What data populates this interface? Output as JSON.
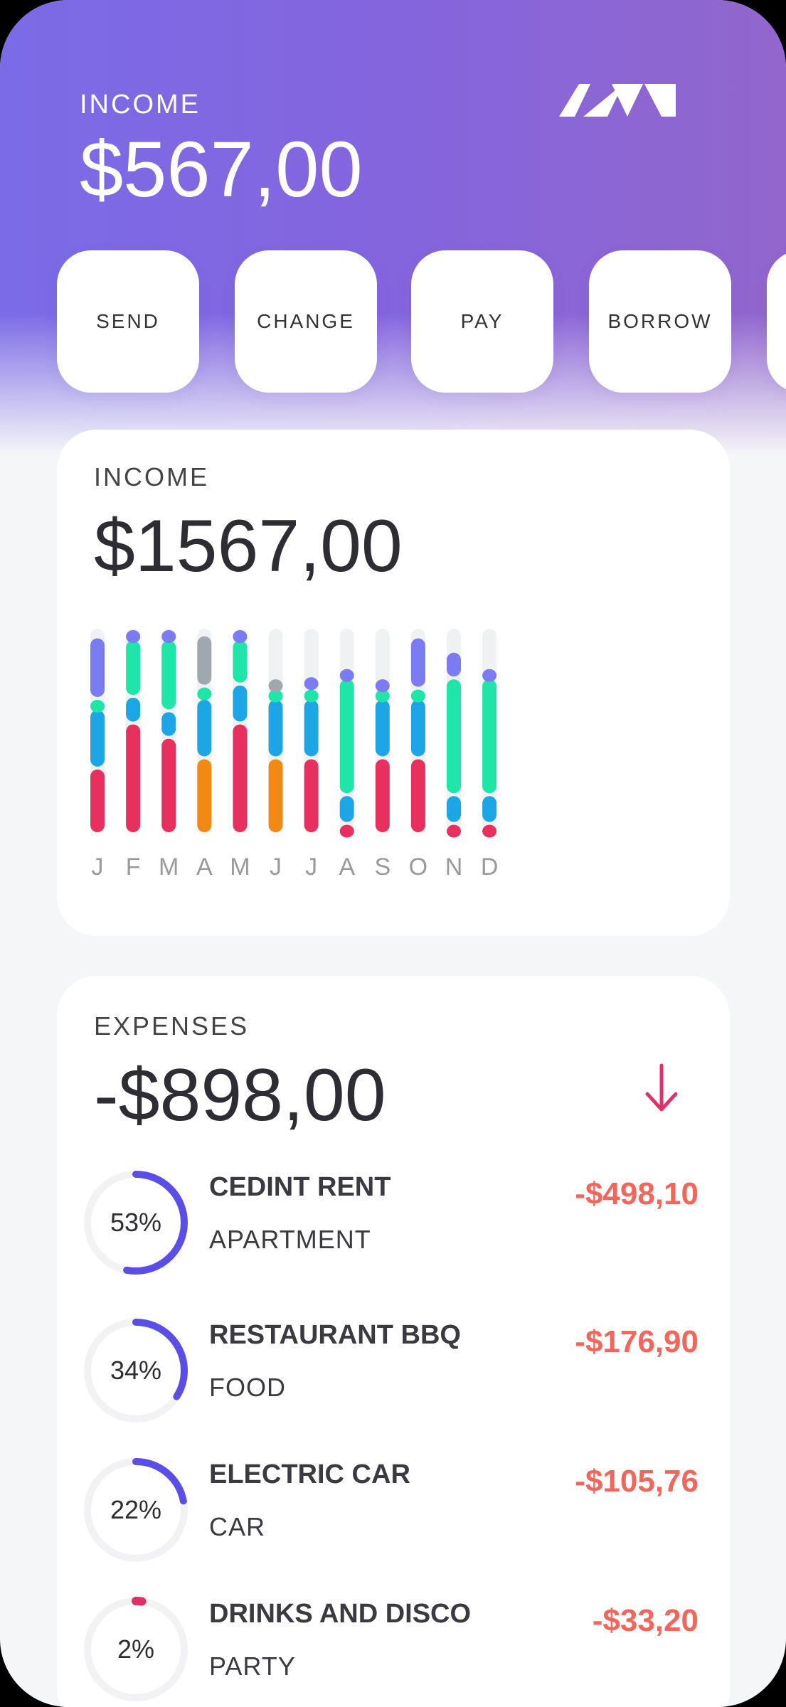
{
  "header": {
    "label": "INCOME",
    "amount": "$567,00",
    "logo_icon": "brand-logo-icon"
  },
  "actions": [
    {
      "label": "SEND"
    },
    {
      "label": "CHANGE"
    },
    {
      "label": "PAY"
    },
    {
      "label": "BORROW"
    }
  ],
  "income_card": {
    "label": "INCOME",
    "amount": "$1567,00"
  },
  "chart_data": {
    "type": "bar",
    "title": "",
    "categories": [
      "J",
      "F",
      "M",
      "A",
      "M",
      "J",
      "J",
      "A",
      "S",
      "O",
      "N",
      "D"
    ],
    "stacked": true,
    "colors": {
      "red": "#e8305f",
      "orange": "#f08a14",
      "blue": "#1da6e6",
      "green": "#1fe6a8",
      "purple": "#7b7bf2",
      "gray": "#a0a8ae",
      "track": "#f0f1f3"
    },
    "series_colors_per_month": [
      [
        "red",
        "blue",
        "green",
        "purple"
      ],
      [
        "red",
        "blue",
        "green",
        "purple"
      ],
      [
        "red",
        "blue",
        "green",
        "purple"
      ],
      [
        "orange",
        "blue",
        "green",
        "gray"
      ],
      [
        "red",
        "blue",
        "green",
        "purple"
      ],
      [
        "orange",
        "blue",
        "green",
        "gray"
      ],
      [
        "red",
        "blue",
        "green",
        "purple"
      ],
      [
        "red",
        "blue",
        "green",
        "purple"
      ],
      [
        "red",
        "blue",
        "green",
        "purple"
      ],
      [
        "red",
        "blue",
        "green",
        "purple"
      ],
      [
        "red",
        "blue",
        "green",
        "purple"
      ],
      [
        "red",
        "blue",
        "green",
        "purple"
      ]
    ],
    "values": [
      [
        32,
        29,
        5,
        30
      ],
      [
        54,
        13,
        28,
        5
      ],
      [
        47,
        13,
        35,
        5
      ],
      [
        37,
        29,
        6,
        25
      ],
      [
        54,
        19,
        22,
        5
      ],
      [
        37,
        29,
        5,
        5
      ],
      [
        37,
        29,
        5,
        6
      ],
      [
        5,
        14,
        57,
        5
      ],
      [
        37,
        29,
        5,
        5
      ],
      [
        37,
        29,
        5,
        25
      ],
      [
        5,
        14,
        57,
        13
      ],
      [
        5,
        14,
        57,
        5
      ]
    ]
  },
  "expenses_card": {
    "label": "EXPENSES",
    "amount": "-$898,00",
    "arrow_icon": "arrow-down-icon",
    "items": [
      {
        "title": "CEDINT RENT",
        "category": "APARTMENT",
        "amount": "-$498,10",
        "percent_label": "53%",
        "percent": 53
      },
      {
        "title": "RESTAURANT BBQ",
        "category": "FOOD",
        "amount": "-$176,90",
        "percent_label": "34%",
        "percent": 34
      },
      {
        "title": "ELECTRIC CAR",
        "category": "CAR",
        "amount": "-$105,76",
        "percent_label": "22%",
        "percent": 22
      },
      {
        "title": "DRINKS AND DISCO",
        "category": "PARTY",
        "amount": "-$33,20",
        "percent_label": "2%",
        "percent": 2
      }
    ]
  }
}
